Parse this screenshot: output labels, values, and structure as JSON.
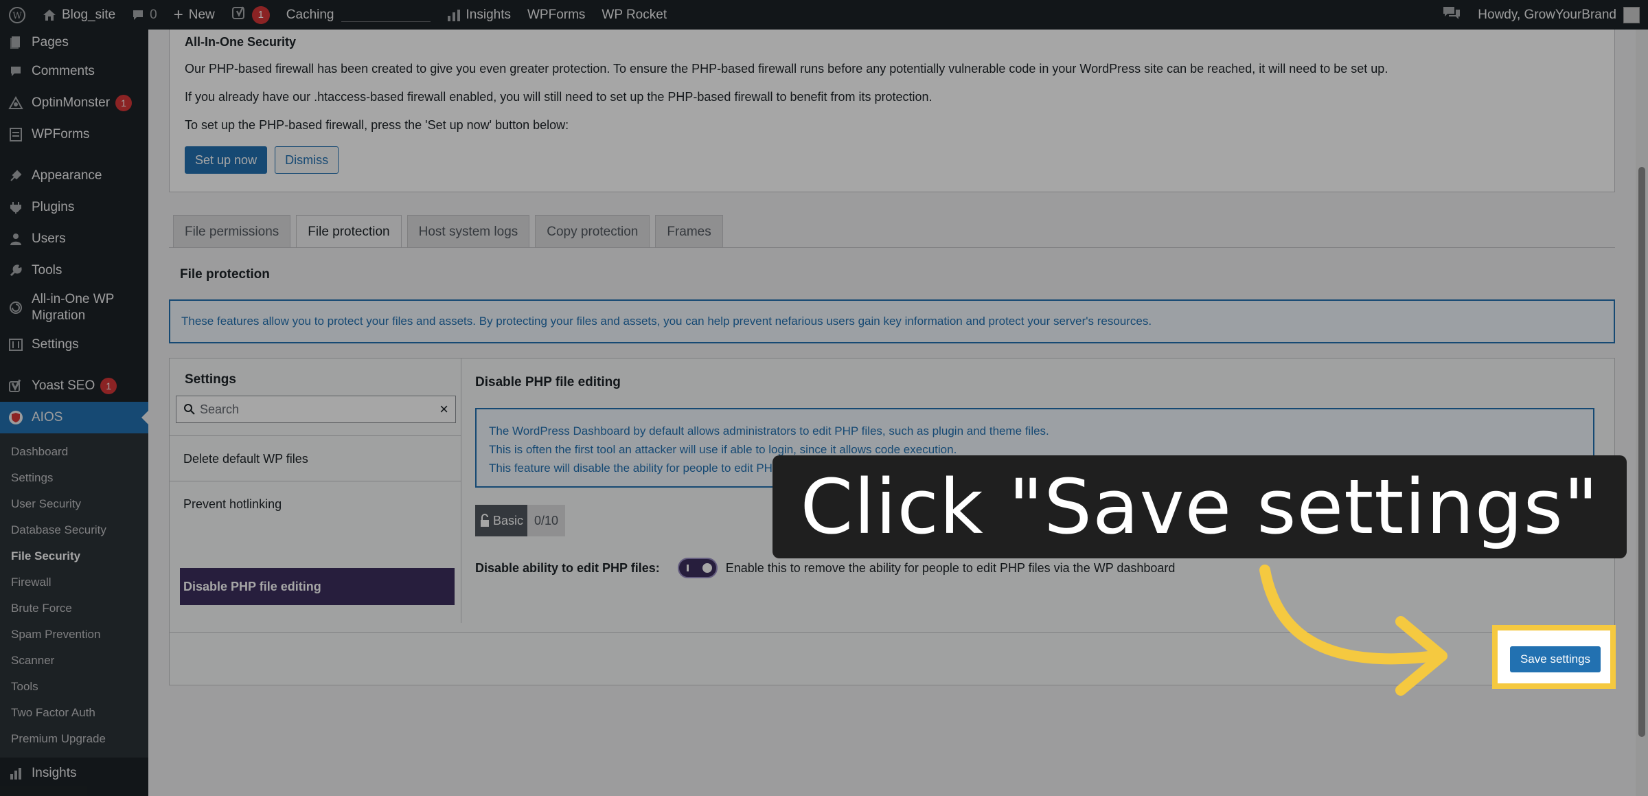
{
  "adminbar": {
    "site_name": "Blog_site",
    "comments_count": "0",
    "new_label": "New",
    "yoast_badge": "1",
    "caching_label": "Caching",
    "insights_label": "Insights",
    "wpforms_label": "WPForms",
    "wprocket_label": "WP Rocket",
    "greeting": "Howdy, GrowYourBrand"
  },
  "sidebar": {
    "items": [
      {
        "label": "Pages",
        "icon": "pages-icon"
      },
      {
        "label": "Comments",
        "icon": "comments-icon"
      },
      {
        "label": "OptinMonster",
        "icon": "optinmonster-icon",
        "badge": "1"
      },
      {
        "label": "WPForms",
        "icon": "wpforms-icon"
      },
      {
        "label": "Appearance",
        "icon": "appearance-icon"
      },
      {
        "label": "Plugins",
        "icon": "plugins-icon"
      },
      {
        "label": "Users",
        "icon": "users-icon"
      },
      {
        "label": "Tools",
        "icon": "tools-icon"
      },
      {
        "label": "All-in-One WP Migration",
        "icon": "migration-icon"
      },
      {
        "label": "Settings",
        "icon": "settings-icon"
      },
      {
        "label": "Yoast SEO",
        "icon": "yoast-icon",
        "badge": "1"
      },
      {
        "label": "AIOS",
        "icon": "aios-icon"
      }
    ],
    "submenu": [
      "Dashboard",
      "Settings",
      "User Security",
      "Database Security",
      "File Security",
      "Firewall",
      "Brute Force",
      "Spam Prevention",
      "Scanner",
      "Tools",
      "Two Factor Auth",
      "Premium Upgrade"
    ],
    "bottom_item": "Insights"
  },
  "notice": {
    "title": "All-In-One Security",
    "p1": "Our PHP-based firewall has been created to give you even greater protection. To ensure the PHP-based firewall runs before any potentially vulnerable code in your WordPress site can be reached, it will need to be set up.",
    "p2": "If you already have our .htaccess-based firewall enabled, you will still need to set up the PHP-based firewall to benefit from its protection.",
    "p3": "To set up the PHP-based firewall, press the 'Set up now' button below:",
    "setup_button": "Set up now",
    "dismiss_button": "Dismiss"
  },
  "tabs": [
    "File permissions",
    "File protection",
    "Host system logs",
    "Copy protection",
    "Frames"
  ],
  "section_title": "File protection",
  "info_text": "These features allow you to protect your files and assets. By protecting your files and assets, you can help prevent nefarious users gain key information and protect your server's resources.",
  "settings_panel": {
    "title": "Settings",
    "search_placeholder": "Search",
    "items": [
      "Delete default WP files",
      "Prevent hotlinking",
      "Disable PHP file editing"
    ]
  },
  "feature": {
    "title": "Disable PHP file editing",
    "line1": "The WordPress Dashboard by default allows administrators to edit PHP files, such as plugin and theme files.",
    "line2": "This is often the first tool an attacker will use if able to login, since it allows code execution.",
    "line3": "This feature will disable the ability for people to edit PHP files via the dashboard.",
    "badge_label": "Basic",
    "badge_score": "0/10",
    "toggle_label": "Disable ability to edit PHP files:",
    "toggle_desc": "Enable this to remove the ability for people to edit PHP files via the WP dashboard",
    "toggle_on": true
  },
  "save_button": "Save settings",
  "callout": "Click \"Save settings\"",
  "colors": {
    "accent": "#2271b1",
    "highlight": "#f5c940",
    "selected_item": "#3c2f5e",
    "adminbar": "#1d2327"
  }
}
